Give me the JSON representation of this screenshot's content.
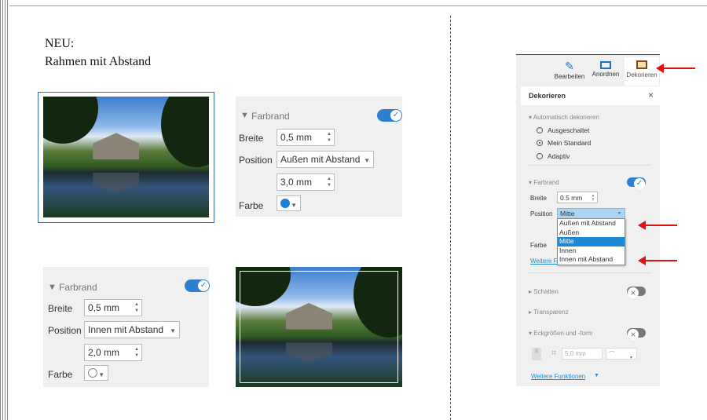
{
  "heading": {
    "line1": "NEU:",
    "line2": "Rahmen mit Abstand"
  },
  "panel_outer": {
    "section": "Farbrand",
    "toggle_on": true,
    "width_label": "Breite",
    "width_value": "0,5 mm",
    "position_label": "Position",
    "position_value": "Außen mit Abstand",
    "distance_value": "3,0 mm",
    "color_label": "Farbe",
    "color": "#1e7fd8"
  },
  "panel_inner": {
    "section": "Farbrand",
    "toggle_on": true,
    "width_label": "Breite",
    "width_value": "0,5 mm",
    "position_label": "Position",
    "position_value": "Innen mit Abstand",
    "distance_value": "2,0 mm",
    "color_label": "Farbe",
    "color": "#ffffff"
  },
  "sidebar": {
    "tabs": [
      {
        "label": "Bearbeiten",
        "icon": "edit-icon"
      },
      {
        "label": "Anordnen",
        "icon": "arrange-icon"
      },
      {
        "label": "Dekorieren",
        "icon": "frame-icon",
        "active": true
      }
    ],
    "title": "Dekorieren",
    "auto_section": "Automatisch dekorieren",
    "auto_options": [
      {
        "label": "Ausgeschaltet",
        "checked": false
      },
      {
        "label": "Mein Standard",
        "checked": true
      },
      {
        "label": "Adaptiv",
        "checked": false
      }
    ],
    "farbrand": "Farbrand",
    "farbrand_on": true,
    "width_label": "Breite",
    "width_value": "0.5 mm",
    "position_label": "Position",
    "position_value": "Mitte",
    "position_options": [
      "Außen mit Abstand",
      "Außen",
      "Mitte",
      "Innen",
      "Innen mit Abstand"
    ],
    "color_label": "Farbe",
    "more_link_partial": "Weitere F",
    "schatten": "Schatten",
    "schatten_on": false,
    "transparenz": "Transparenz",
    "ecken": "Eckgrößen und -form",
    "ecken_on": false,
    "corner_value": "5.0 mm",
    "more_functions": "Weitere Funktionen"
  },
  "colors": {
    "accent": "#1e8ad6",
    "annotation_arrow": "#e01010",
    "sidebar_top_bar": "#c0141e"
  }
}
